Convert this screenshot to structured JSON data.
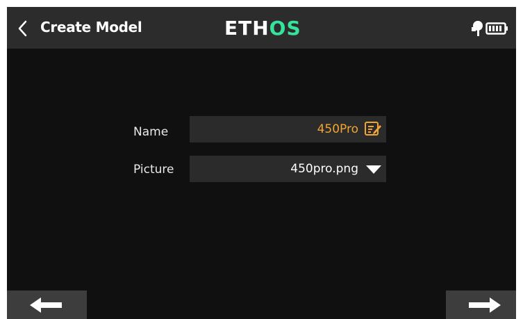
{
  "header": {
    "title": "Create Model",
    "logo_part1": "ETH",
    "logo_part2": "OS",
    "logo_color_main": "#ffffff",
    "logo_color_accent": "#35e39a"
  },
  "form": {
    "name": {
      "label": "Name",
      "value": "450Pro",
      "value_color": "#f2a533",
      "icon": "edit-icon"
    },
    "picture": {
      "label": "Picture",
      "value": "450pro.png",
      "icon": "dropdown-triangle-icon"
    }
  },
  "footer": {
    "prev_icon": "arrow-left-icon",
    "next_icon": "arrow-right-icon"
  },
  "status": {
    "icons": [
      "antenna-icon",
      "battery-icon"
    ]
  }
}
